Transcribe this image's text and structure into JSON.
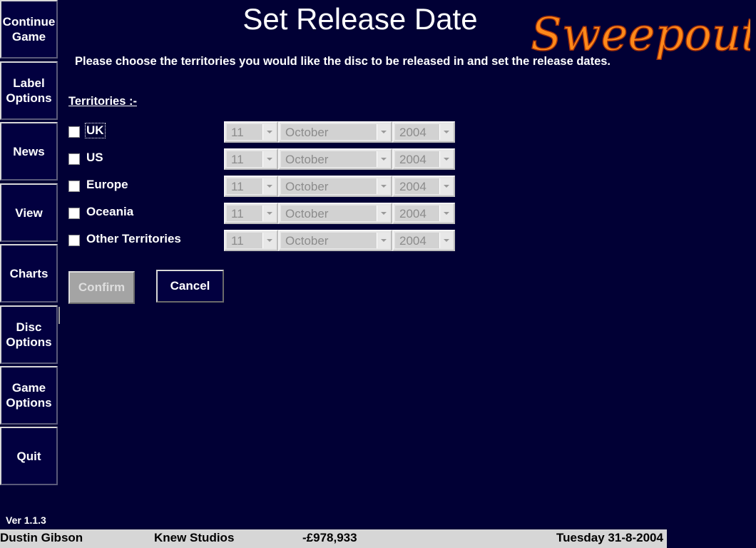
{
  "sidebar": {
    "items": [
      {
        "label": "Continue\nGame"
      },
      {
        "label": "Label\nOptions"
      },
      {
        "label": "News"
      },
      {
        "label": "View"
      },
      {
        "label": "Charts"
      },
      {
        "label": "Disc\nOptions"
      },
      {
        "label": "Game\nOptions"
      },
      {
        "label": "Quit"
      }
    ]
  },
  "header": {
    "title": "Set Release Date",
    "logo_text": "Sweepout"
  },
  "main": {
    "instructions": "Please choose the territories you would like the disc to be released in and set the release dates.",
    "territories_heading": "Territories :-",
    "territories": [
      {
        "name": "UK",
        "checked": false,
        "day": "11",
        "month": "October",
        "year": "2004"
      },
      {
        "name": "US",
        "checked": false,
        "day": "11",
        "month": "October",
        "year": "2004"
      },
      {
        "name": "Europe",
        "checked": false,
        "day": "11",
        "month": "October",
        "year": "2004"
      },
      {
        "name": "Oceania",
        "checked": false,
        "day": "11",
        "month": "October",
        "year": "2004"
      },
      {
        "name": "Other Territories",
        "checked": false,
        "day": "11",
        "month": "October",
        "year": "2004"
      }
    ],
    "confirm_label": "Confirm",
    "cancel_label": "Cancel"
  },
  "footer": {
    "version": "Ver 1.1.3",
    "player_name": "Dustin Gibson",
    "studio_name": "Knew Studios",
    "balance": "-£978,933",
    "date": "Tuesday 31-8-2004"
  },
  "colors": {
    "background": "#010035",
    "logo_orange": "#ff8a1a",
    "status_bar": "#d6d6d6"
  }
}
